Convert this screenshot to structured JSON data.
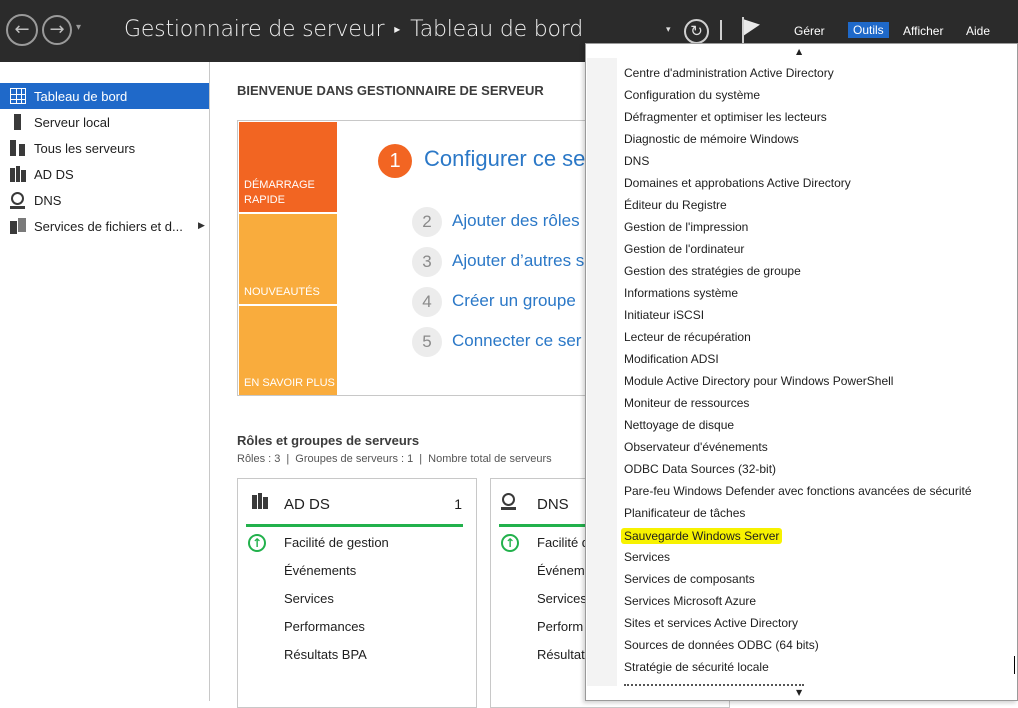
{
  "window": {
    "title": "Gestionnaire de serveur",
    "separator": "▸",
    "page": "Tableau de bord"
  },
  "titlebar": {
    "back_glyph": "←",
    "forward_glyph": "→",
    "dropdown_glyph": "▾",
    "refresh_glyph": "↻",
    "menus": [
      "Gérer",
      "Outils",
      "Afficher",
      "Aide"
    ]
  },
  "sidebar": {
    "items": [
      {
        "label": "Tableau de bord",
        "icon": "dashboard-icon",
        "active": true
      },
      {
        "label": "Serveur local",
        "icon": "server-icon"
      },
      {
        "label": "Tous les serveurs",
        "icon": "servers-icon"
      },
      {
        "label": "AD DS",
        "icon": "adds-icon"
      },
      {
        "label": "DNS",
        "icon": "dns-icon"
      },
      {
        "label": "Services de fichiers et d...",
        "icon": "file-services-icon",
        "has_submenu": true
      }
    ],
    "submenu_glyph": "▶"
  },
  "main": {
    "welcome": "BIENVENUE DANS GESTIONNAIRE DE SERVEUR",
    "tiles": [
      "DÉMARRAGE RAPIDE",
      "NOUVEAUTÉS",
      "EN SAVOIR PLUS"
    ],
    "steps": [
      {
        "num": "1",
        "text": "Configurer ce se"
      },
      {
        "num": "2",
        "text": "Ajouter des rôles"
      },
      {
        "num": "3",
        "text": "Ajouter d’autres s"
      },
      {
        "num": "4",
        "text": "Créer un groupe"
      },
      {
        "num": "5",
        "text": "Connecter ce ser"
      }
    ],
    "roles_title": "Rôles et groupes de serveurs",
    "roles_sub": [
      "Rôles : 3",
      "Groupes de serveurs : 1",
      "Nombre total de serveurs"
    ],
    "cards": [
      {
        "title": "AD DS",
        "count": "1",
        "rows": [
          "Facilité de gestion",
          "Événements",
          "Services",
          "Performances",
          "Résultats BPA"
        ]
      },
      {
        "title": "DNS",
        "count": "",
        "rows": [
          "Facilité d",
          "Événem",
          "Services",
          "Perform",
          "Résultat"
        ]
      }
    ],
    "ok_glyph": "↑"
  },
  "tools_menu": {
    "scroll_up": "▲",
    "scroll_down": "▼",
    "highlight_color": "#f7f200",
    "items": [
      "Centre d'administration Active Directory",
      "Configuration du système",
      "Défragmenter et optimiser les lecteurs",
      "Diagnostic de mémoire Windows",
      "DNS",
      "Domaines et approbations Active Directory",
      "Éditeur du Registre",
      "Gestion de l'impression",
      "Gestion de l'ordinateur",
      "Gestion des stratégies de groupe",
      "Informations système",
      "Initiateur iSCSI",
      "Lecteur de récupération",
      "Modification ADSI",
      "Module Active Directory pour Windows PowerShell",
      "Moniteur de ressources",
      "Nettoyage de disque",
      "Observateur d'événements",
      "ODBC Data Sources (32-bit)",
      "Pare-feu Windows Defender avec fonctions avancées de sécurité",
      "Planificateur de tâches",
      "Sauvegarde Windows Server",
      "Services",
      "Services de composants",
      "Services Microsoft Azure",
      "Sites et services Active Directory",
      "Sources de données ODBC (64 bits)",
      "Stratégie de sécurité locale"
    ],
    "highlighted": "Sauvegarde Windows Server"
  }
}
